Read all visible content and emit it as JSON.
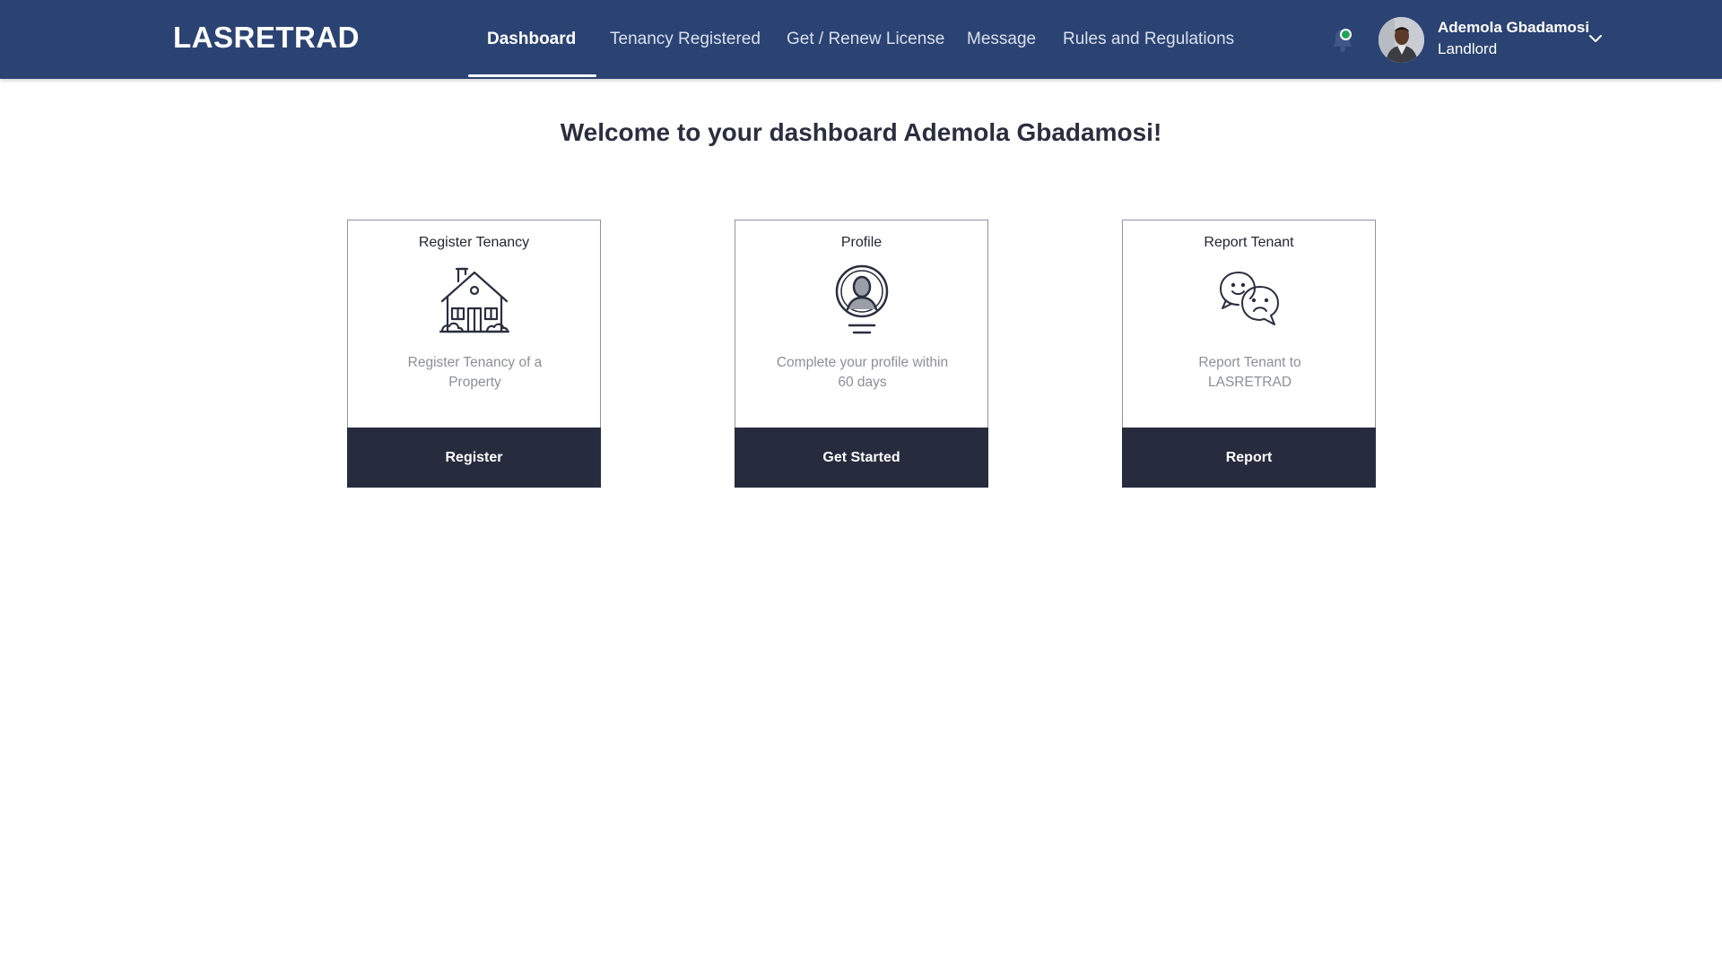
{
  "header": {
    "brand": "LASRETRAD",
    "nav": [
      {
        "label": "Dashboard",
        "active": true
      },
      {
        "label": "Tenancy Registered",
        "active": false
      },
      {
        "label": "Get / Renew License",
        "active": false
      },
      {
        "label": "Message",
        "active": false
      },
      {
        "label": "Rules and Regulations",
        "active": false
      }
    ],
    "notifications": {
      "icon": "bell-icon",
      "status_color": "#21a35a"
    },
    "user": {
      "name": "Ademola Gbadamosi",
      "role": "Landlord",
      "dropdown_icon": "chevron-down-icon"
    }
  },
  "main": {
    "welcome": "Welcome to your dashboard Ademola Gbadamosi!",
    "cards": [
      {
        "title": "Register Tenancy",
        "icon": "house-icon",
        "description": "Register Tenancy of a Property",
        "button": "Register"
      },
      {
        "title": "Profile",
        "icon": "profile-icon",
        "description": "Complete your profile within 60 days",
        "button": "Get Started"
      },
      {
        "title": "Report Tenant",
        "icon": "chat-faces-icon",
        "description": "Report Tenant to LASRETRAD",
        "button": "Report"
      }
    ]
  },
  "colors": {
    "header_bg": "#2a4373",
    "button_bg": "#262b3d",
    "text_dark": "#2a2f3f",
    "text_muted": "#8c8f98"
  }
}
